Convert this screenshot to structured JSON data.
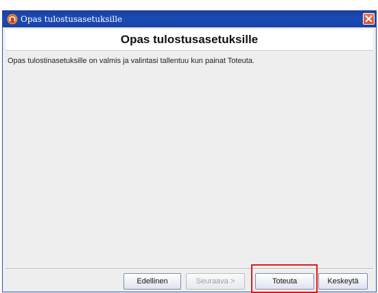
{
  "window": {
    "title": "Opas tulostusasetuksille",
    "titlebar_color": "#1b4bb5",
    "close_color": "#d44a2e"
  },
  "header": {
    "title": "Opas tulostusasetuksille"
  },
  "body": {
    "message": "Opas tulostinasetuksille on valmis ja valintasi tallentuu kun painat Toteuta."
  },
  "buttons": {
    "previous": "Edellinen",
    "next": "Seuraava >",
    "finish": "Toteuta",
    "cancel": "Keskeytä"
  },
  "highlight": {
    "target": "finish",
    "color": "#e01818"
  }
}
